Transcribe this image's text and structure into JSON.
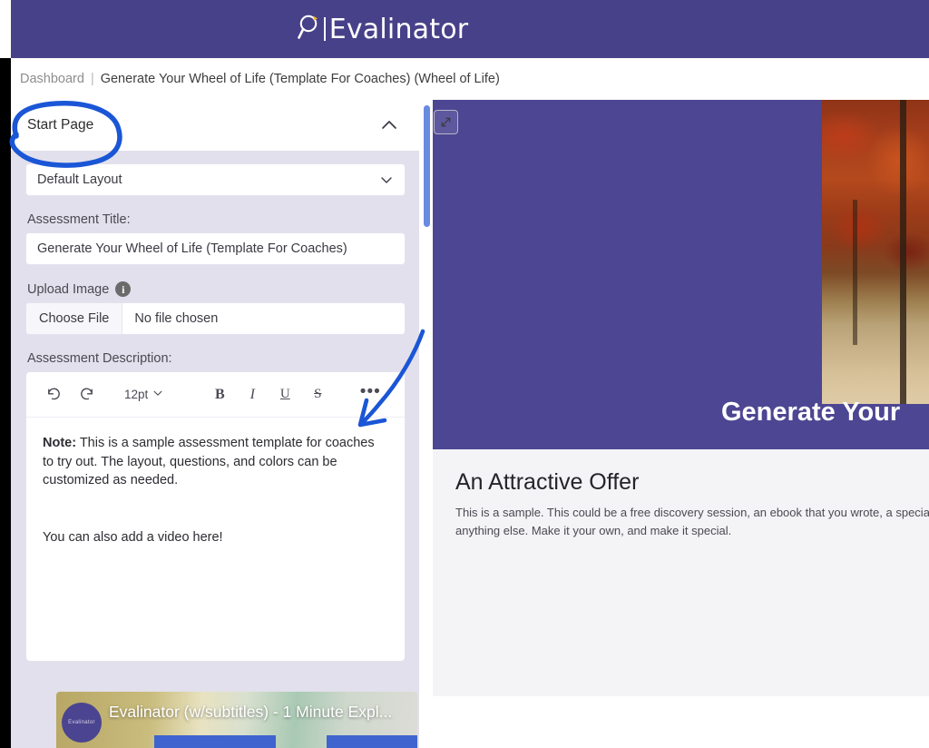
{
  "header": {
    "logo_text": "Evalinator",
    "logo_icon": "magnifying-glass-icon",
    "background_color": "#474189"
  },
  "breadcrumb": {
    "home": "Dashboard",
    "separator": "|",
    "current": "Generate Your Wheel of Life (Template For Coaches) (Wheel of Life)"
  },
  "editor_panel": {
    "section_title": "Start Page",
    "collapse_icon": "chevron-up-icon",
    "layout_select": {
      "value": "Default Layout",
      "chevron_icon": "chevron-down-icon"
    },
    "assessment_title": {
      "label": "Assessment Title:",
      "value": "Generate Your Wheel of Life (Template For Coaches)"
    },
    "upload_image": {
      "label": "Upload Image",
      "info_icon": "info-icon",
      "info_glyph": "i",
      "choose_button": "Choose File",
      "file_status": "No file chosen"
    },
    "assessment_description": {
      "label": "Assessment Description:",
      "toolbar": {
        "undo_icon": "undo-icon",
        "redo_icon": "redo-icon",
        "font_size": "12pt",
        "font_size_chevron": "chevron-down-icon",
        "bold": "B",
        "italic": "I",
        "underline": "U",
        "strikethrough": "S",
        "more": "•••"
      },
      "content": {
        "note_label": "Note:",
        "paragraph1": " This is a sample assessment template for coaches to try out. The layout, questions, and colors can be customized as needed.",
        "paragraph2": "You can also add a video here!"
      },
      "video": {
        "title": "Evalinator (w/subtitles) - 1 Minute Expl...",
        "channel_badge": "Evalinator"
      }
    }
  },
  "preview_panel": {
    "expand_icon": "expand-diagonal-icon",
    "scrollbar": "vertical-scrollbar",
    "hero": {
      "title": "Generate Your",
      "background_color": "#4c4693",
      "image": "autumn-forest-photo"
    },
    "offer": {
      "title": "An Attractive Offer",
      "line1": "This is a sample. This could be a free discovery session, an ebook that you wrote, a special dis",
      "line2": "anything else. Make it your own, and make it special."
    }
  },
  "annotations": {
    "circle_target": "Start Page",
    "arrow_target": "more-options-button",
    "ink_color": "#1a56d6"
  }
}
